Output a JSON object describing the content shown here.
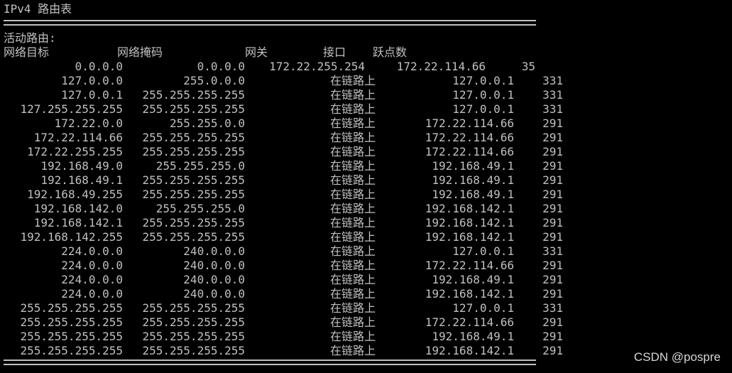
{
  "title": "IPv4 路由表",
  "section_label": "活动路由:",
  "columns": {
    "destination": "网络目标",
    "netmask": "网络掩码",
    "gateway": "网关",
    "interface": "接口",
    "metric": "跃点数"
  },
  "rows": [
    {
      "destination": "0.0.0.0",
      "netmask": "0.0.0.0",
      "gateway": "172.22.255.254",
      "interface": "172.22.114.66",
      "metric": "35"
    },
    {
      "destination": "127.0.0.0",
      "netmask": "255.0.0.0",
      "gateway": "在链路上",
      "interface": "127.0.0.1",
      "metric": "331"
    },
    {
      "destination": "127.0.0.1",
      "netmask": "255.255.255.255",
      "gateway": "在链路上",
      "interface": "127.0.0.1",
      "metric": "331"
    },
    {
      "destination": "127.255.255.255",
      "netmask": "255.255.255.255",
      "gateway": "在链路上",
      "interface": "127.0.0.1",
      "metric": "331"
    },
    {
      "destination": "172.22.0.0",
      "netmask": "255.255.0.0",
      "gateway": "在链路上",
      "interface": "172.22.114.66",
      "metric": "291"
    },
    {
      "destination": "172.22.114.66",
      "netmask": "255.255.255.255",
      "gateway": "在链路上",
      "interface": "172.22.114.66",
      "metric": "291"
    },
    {
      "destination": "172.22.255.255",
      "netmask": "255.255.255.255",
      "gateway": "在链路上",
      "interface": "172.22.114.66",
      "metric": "291"
    },
    {
      "destination": "192.168.49.0",
      "netmask": "255.255.255.0",
      "gateway": "在链路上",
      "interface": "192.168.49.1",
      "metric": "291"
    },
    {
      "destination": "192.168.49.1",
      "netmask": "255.255.255.255",
      "gateway": "在链路上",
      "interface": "192.168.49.1",
      "metric": "291"
    },
    {
      "destination": "192.168.49.255",
      "netmask": "255.255.255.255",
      "gateway": "在链路上",
      "interface": "192.168.49.1",
      "metric": "291"
    },
    {
      "destination": "192.168.142.0",
      "netmask": "255.255.255.0",
      "gateway": "在链路上",
      "interface": "192.168.142.1",
      "metric": "291"
    },
    {
      "destination": "192.168.142.1",
      "netmask": "255.255.255.255",
      "gateway": "在链路上",
      "interface": "192.168.142.1",
      "metric": "291"
    },
    {
      "destination": "192.168.142.255",
      "netmask": "255.255.255.255",
      "gateway": "在链路上",
      "interface": "192.168.142.1",
      "metric": "291"
    },
    {
      "destination": "224.0.0.0",
      "netmask": "240.0.0.0",
      "gateway": "在链路上",
      "interface": "127.0.0.1",
      "metric": "331"
    },
    {
      "destination": "224.0.0.0",
      "netmask": "240.0.0.0",
      "gateway": "在链路上",
      "interface": "172.22.114.66",
      "metric": "291"
    },
    {
      "destination": "224.0.0.0",
      "netmask": "240.0.0.0",
      "gateway": "在链路上",
      "interface": "192.168.49.1",
      "metric": "291"
    },
    {
      "destination": "224.0.0.0",
      "netmask": "240.0.0.0",
      "gateway": "在链路上",
      "interface": "192.168.142.1",
      "metric": "291"
    },
    {
      "destination": "255.255.255.255",
      "netmask": "255.255.255.255",
      "gateway": "在链路上",
      "interface": "127.0.0.1",
      "metric": "331"
    },
    {
      "destination": "255.255.255.255",
      "netmask": "255.255.255.255",
      "gateway": "在链路上",
      "interface": "172.22.114.66",
      "metric": "291"
    },
    {
      "destination": "255.255.255.255",
      "netmask": "255.255.255.255",
      "gateway": "在链路上",
      "interface": "192.168.49.1",
      "metric": "291"
    },
    {
      "destination": "255.255.255.255",
      "netmask": "255.255.255.255",
      "gateway": "在链路上",
      "interface": "192.168.142.1",
      "metric": "291"
    }
  ],
  "watermark": "CSDN @pospre",
  "colors": {
    "background": "#000000",
    "text": "#c0c0c0"
  }
}
